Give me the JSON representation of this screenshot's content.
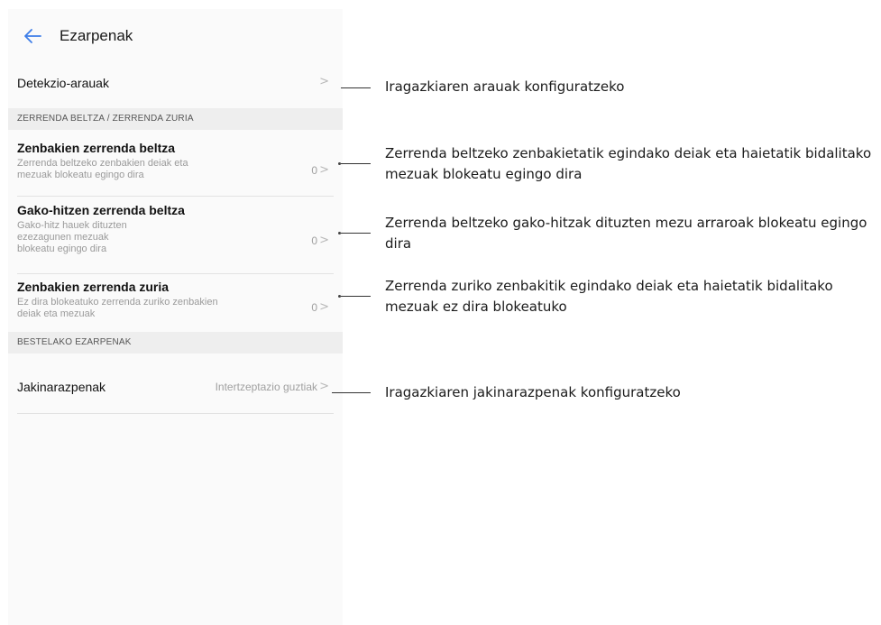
{
  "header": {
    "title": "Ezarpenak"
  },
  "rows": {
    "detection": {
      "title": "Detekzio-arauak"
    },
    "blacklist_numbers": {
      "title": "Zenbakien zerrenda beltza",
      "subtitle": "Zerrenda beltzeko zenbakien deiak eta mezuak blokeatu egingo dira",
      "count": "0"
    },
    "blacklist_keywords": {
      "title": "Gako-hitzen zerrenda beltza",
      "subtitle": "Gako-hitz hauek dituzten ezezagunen mezuak blokeatu egingo dira",
      "count": "0"
    },
    "whitelist_numbers": {
      "title": "Zenbakien zerrenda zuria",
      "subtitle": "Ez dira blokeatuko zerrenda zuriko zenbakien deiak eta mezuak",
      "count": "0"
    },
    "notifications": {
      "title": "Jakinarazpenak",
      "value": "Intertzeptazio guztiak"
    }
  },
  "sections": {
    "blackwhite": "ZERRENDA BELTZA / ZERRENDA ZURIA",
    "other": "BESTELAKO EZARPENAK"
  },
  "annotations": {
    "detection": "Iragazkiaren arauak konfiguratzeko",
    "blacklist_numbers": "Zerrenda beltzeko zenbakietatik egindako deiak eta haietatik bidalitako mezuak blokeatu egingo dira",
    "blacklist_keywords": "Zerrenda beltzeko gako-hitzak dituzten mezu arraroak blokeatu egingo dira",
    "whitelist_numbers": "Zerrenda zuriko zenbakitik egindako deiak eta haietatik bidalitako mezuak ez dira blokeatuko",
    "notifications": "Iragazkiaren jakinarazpenak konfiguratzeko"
  },
  "icons": {
    "back": "arrow-left-icon",
    "chevron": "chevron-right-icon"
  },
  "colors": {
    "accent": "#3d7de8",
    "section_bg": "#eeeeee",
    "panel_bg": "#fafafa"
  }
}
